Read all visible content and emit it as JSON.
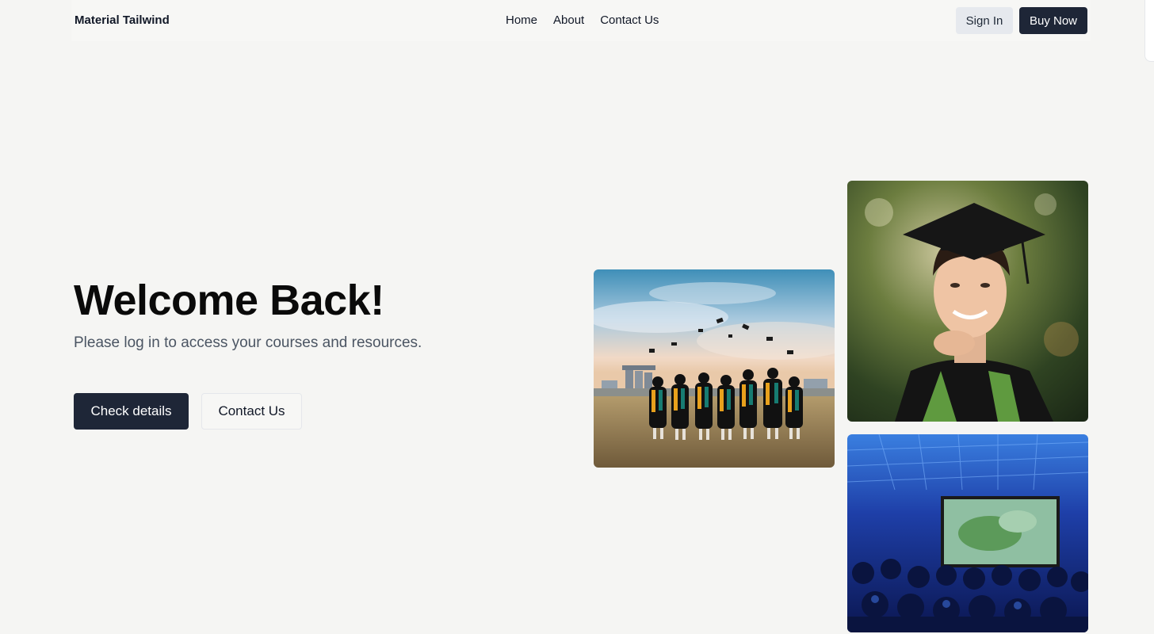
{
  "nav": {
    "brand": "Material Tailwind",
    "links": [
      "Home",
      "About",
      "Contact Us"
    ],
    "sign_in": "Sign In",
    "buy_now": "Buy Now"
  },
  "hero": {
    "title": "Welcome Back!",
    "subtitle": "Please log in to access your courses and resources.",
    "primary_button": "Check details",
    "secondary_button": "Contact Us"
  },
  "images": {
    "grads": "graduates-throwing-caps-photo",
    "portrait": "graduate-portrait-photo",
    "lecture": "lecture-hall-photo"
  },
  "colors": {
    "background": "#f5f5f3",
    "primary": "#1e2637",
    "secondary": "#e6e9ee",
    "subtitle": "#4b5563"
  }
}
